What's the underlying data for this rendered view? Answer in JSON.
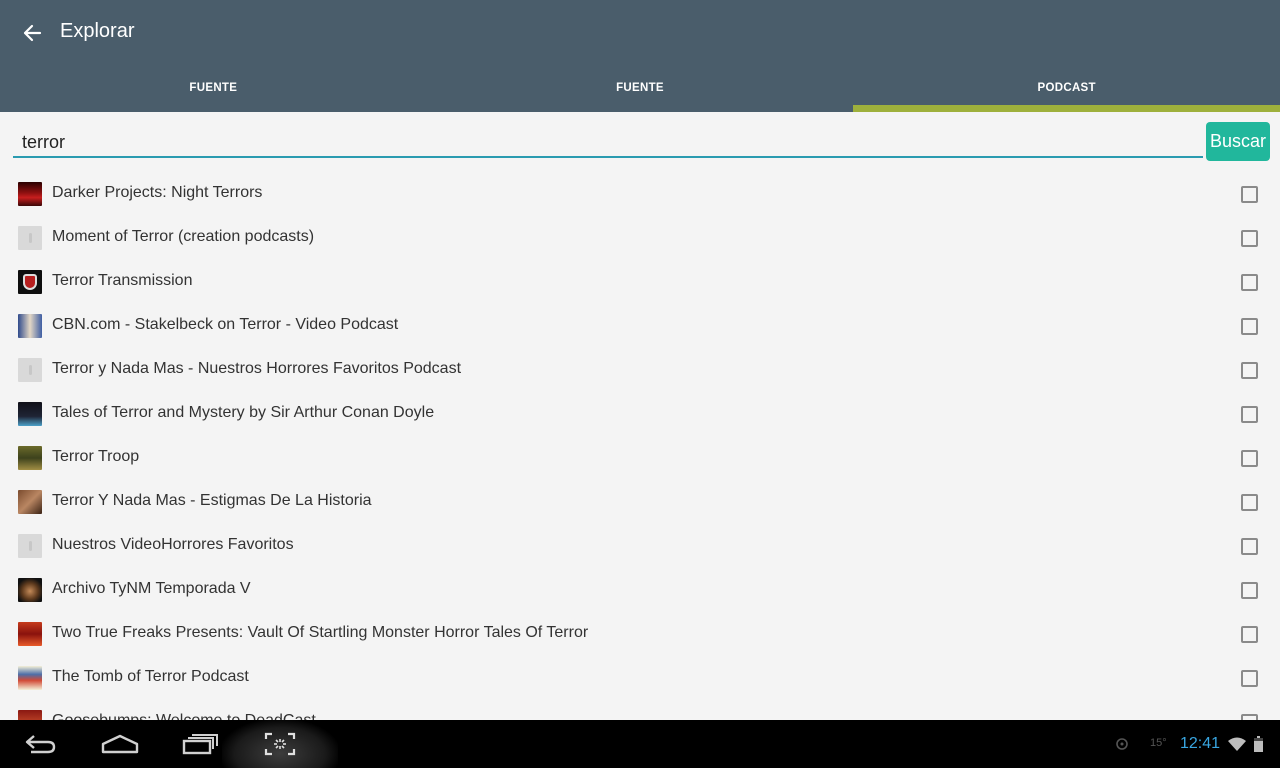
{
  "toolbar": {
    "title": "Explorar",
    "back_icon": "arrow-left-icon"
  },
  "tabs": [
    {
      "label": "FUENTE",
      "active": false
    },
    {
      "label": "FUENTE",
      "active": false
    },
    {
      "label": "PODCAST",
      "active": true
    }
  ],
  "search": {
    "value": "terror",
    "button_label": "Buscar"
  },
  "results": [
    {
      "title": "Darker Projects: Night Terrors",
      "checked": false
    },
    {
      "title": "Moment of Terror (creation podcasts)",
      "checked": false
    },
    {
      "title": "Terror Transmission",
      "checked": false
    },
    {
      "title": "CBN.com - Stakelbeck on Terror - Video Podcast",
      "checked": false
    },
    {
      "title": "Terror y Nada Mas - Nuestros Horrores Favoritos Podcast",
      "checked": false
    },
    {
      "title": "Tales of Terror and Mystery by Sir Arthur Conan Doyle",
      "checked": false
    },
    {
      "title": "Terror Troop",
      "checked": false
    },
    {
      "title": "Terror Y Nada Mas - Estigmas De La Historia",
      "checked": false
    },
    {
      "title": "Nuestros VideoHorrores Favoritos",
      "checked": false
    },
    {
      "title": "Archivo TyNM Temporada V",
      "checked": false
    },
    {
      "title": "Two True Freaks Presents: Vault Of Startling Monster Horror Tales Of Terror",
      "checked": false
    },
    {
      "title": "The Tomb of Terror Podcast",
      "checked": false
    },
    {
      "title": "Goosebumps: Welcome to DeadCast",
      "checked": false
    }
  ],
  "navbar": {
    "back_icon": "nav-back-icon",
    "home_icon": "nav-home-icon",
    "recents_icon": "nav-recents-icon",
    "screenshot_icon": "screenshot-icon"
  },
  "status_bar": {
    "temperature": "15°",
    "time": "12:41"
  },
  "colors": {
    "toolbar": "#4a5d6b",
    "tab_indicator": "#9eb03c",
    "search_underline": "#2a9bb0",
    "button": "#21b79c",
    "clock": "#39a6e1"
  }
}
